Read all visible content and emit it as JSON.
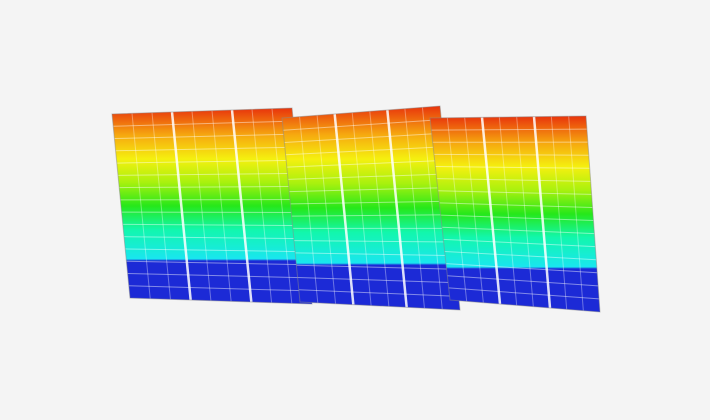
{
  "model": {
    "blocks": 3,
    "stories": 15,
    "bays_per_block": 3,
    "upper_dark_stories_ratio": 0.2
  },
  "contour": {
    "colormap": [
      {
        "stop": 0.0,
        "color": "#1c2ad6"
      },
      {
        "stop": 0.22,
        "color": "#1c2ad6"
      },
      {
        "stop": 0.23,
        "color": "#19e6ef"
      },
      {
        "stop": 0.38,
        "color": "#12f7ad"
      },
      {
        "stop": 0.5,
        "color": "#26e81a"
      },
      {
        "stop": 0.62,
        "color": "#a8f10e"
      },
      {
        "stop": 0.74,
        "color": "#f5f00f"
      },
      {
        "stop": 0.86,
        "color": "#f6a90f"
      },
      {
        "stop": 1.0,
        "color": "#e8330c"
      }
    ]
  },
  "colors": {
    "background": "#f4f4f4",
    "frame_highlight": "#ffffff"
  }
}
